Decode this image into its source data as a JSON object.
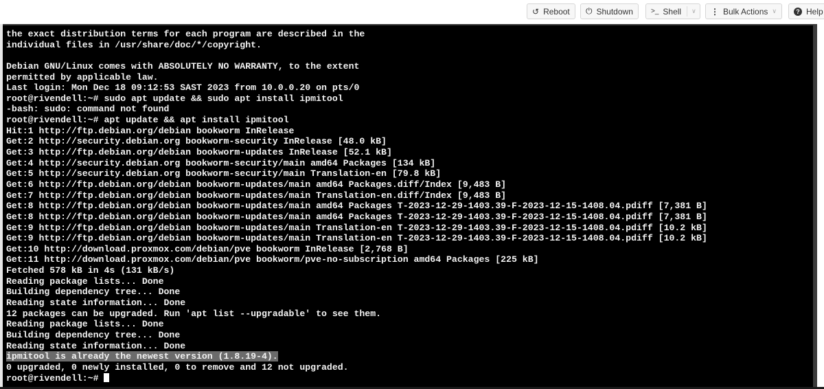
{
  "toolbar": {
    "buttons": [
      {
        "label": "Reboot",
        "icon": "reboot-icon"
      },
      {
        "label": "Shutdown",
        "icon": "power-icon"
      },
      {
        "label": "Shell",
        "icon": "terminal-icon",
        "dropdown": true
      },
      {
        "label": "Bulk Actions",
        "icon": "kebab-icon",
        "dropdown": true
      },
      {
        "label": "Help",
        "icon": "help-icon"
      }
    ],
    "icon_glyphs": {
      "reboot": "↺",
      "power": "⏻",
      "terminal": ">_",
      "kebab": "⋮",
      "help": "?",
      "caret": "∨"
    }
  },
  "terminal": {
    "lines": [
      "the exact distribution terms for each program are described in the",
      "individual files in /usr/share/doc/*/copyright.",
      "",
      "Debian GNU/Linux comes with ABSOLUTELY NO WARRANTY, to the extent",
      "permitted by applicable law.",
      "Last login: Mon Dec 18 09:12:53 SAST 2023 from 10.0.0.20 on pts/0",
      "root@rivendell:~# sudo apt update && sudo apt install ipmitool",
      "-bash: sudo: command not found",
      "root@rivendell:~# apt update && apt install ipmitool",
      "Hit:1 http://ftp.debian.org/debian bookworm InRelease",
      "Get:2 http://security.debian.org bookworm-security InRelease [48.0 kB]",
      "Get:3 http://ftp.debian.org/debian bookworm-updates InRelease [52.1 kB]",
      "Get:4 http://security.debian.org bookworm-security/main amd64 Packages [134 kB]",
      "Get:5 http://security.debian.org bookworm-security/main Translation-en [79.8 kB]",
      "Get:6 http://ftp.debian.org/debian bookworm-updates/main amd64 Packages.diff/Index [9,483 B]",
      "Get:7 http://ftp.debian.org/debian bookworm-updates/main Translation-en.diff/Index [9,483 B]",
      "Get:8 http://ftp.debian.org/debian bookworm-updates/main amd64 Packages T-2023-12-29-1403.39-F-2023-12-15-1408.04.pdiff [7,381 B]",
      "Get:8 http://ftp.debian.org/debian bookworm-updates/main amd64 Packages T-2023-12-29-1403.39-F-2023-12-15-1408.04.pdiff [7,381 B]",
      "Get:9 http://ftp.debian.org/debian bookworm-updates/main Translation-en T-2023-12-29-1403.39-F-2023-12-15-1408.04.pdiff [10.2 kB]",
      "Get:9 http://ftp.debian.org/debian bookworm-updates/main Translation-en T-2023-12-29-1403.39-F-2023-12-15-1408.04.pdiff [10.2 kB]",
      "Get:10 http://download.proxmox.com/debian/pve bookworm InRelease [2,768 B]",
      "Get:11 http://download.proxmox.com/debian/pve bookworm/pve-no-subscription amd64 Packages [225 kB]",
      "Fetched 578 kB in 4s (131 kB/s)",
      "Reading package lists... Done",
      "Building dependency tree... Done",
      "Reading state information... Done",
      "12 packages can be upgraded. Run 'apt list --upgradable' to see them.",
      "Reading package lists... Done",
      "Building dependency tree... Done",
      "Reading state information... Done",
      "ipmitool is already the newest version (1.8.19-4).",
      "0 upgraded, 0 newly installed, 0 to remove and 12 not upgraded."
    ],
    "highlighted_line_index": 30,
    "prompt": "root@rivendell:~# "
  },
  "colors": {
    "terminal_bg": "#000000",
    "terminal_fg": "#f2f2f2",
    "selection_bg": "#6b6b6b"
  }
}
